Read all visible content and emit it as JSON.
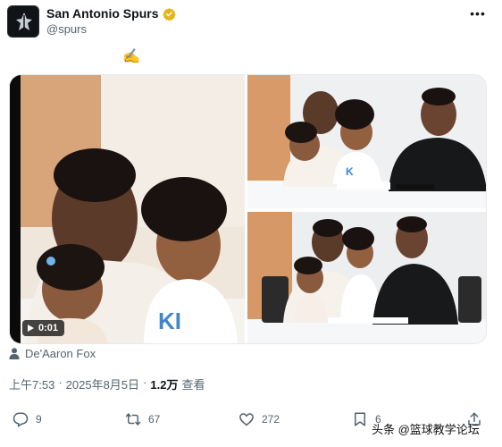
{
  "account": {
    "display_name": "San Antonio Spurs",
    "handle": "@spurs",
    "verified_icon": "verified-badge-icon",
    "more_label": "•••"
  },
  "tweet": {
    "text": "✍️"
  },
  "media": {
    "video_duration": "0:01"
  },
  "tagged_user": "De'Aaron Fox",
  "meta": {
    "time": "上午7:53",
    "date": "2025年8月5日",
    "views_count": "1.2万",
    "views_label": "查看"
  },
  "actions": {
    "replies": "9",
    "retweets": "67",
    "likes": "272",
    "bookmarks": "6"
  },
  "watermark": "头条 @篮球教学论坛",
  "colors": {
    "text": "#0f1419",
    "secondary": "#536471",
    "verified": "#e2b719"
  }
}
